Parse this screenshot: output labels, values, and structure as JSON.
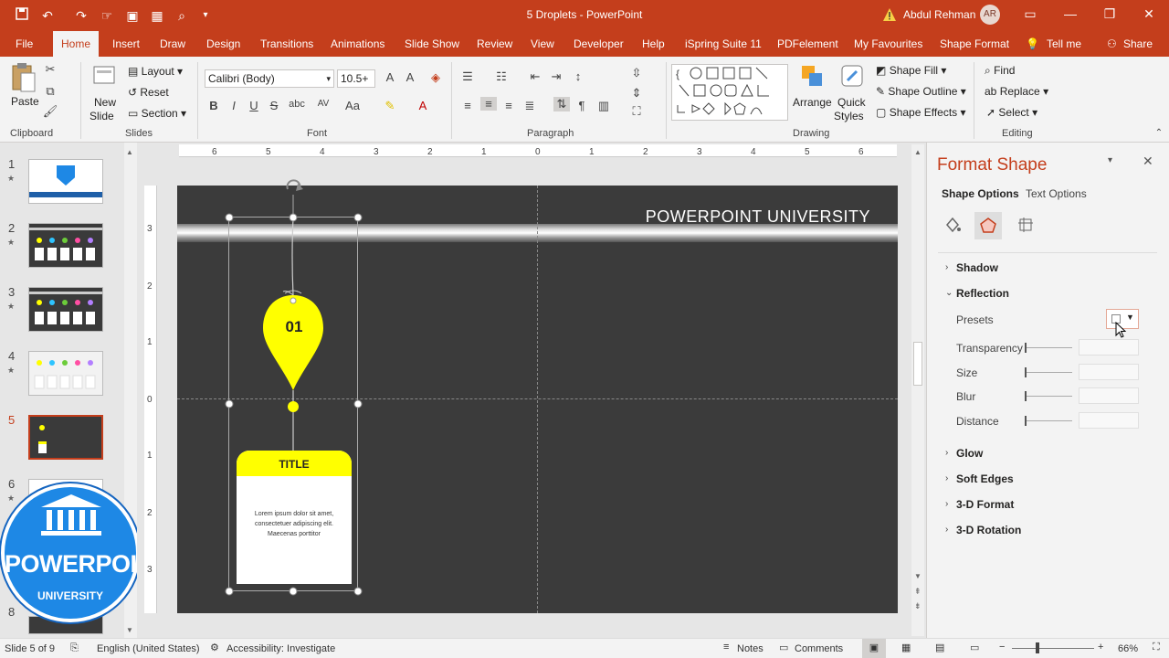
{
  "titlebar": {
    "doc_title": "5 Droplets  -  PowerPoint",
    "user_name": "Abdul Rehman",
    "avatar_initials": "AR"
  },
  "tabs": [
    "File",
    "Home",
    "Insert",
    "Draw",
    "Design",
    "Transitions",
    "Animations",
    "Slide Show",
    "Review",
    "View",
    "Developer",
    "Help",
    "iSpring Suite 11",
    "PDFelement",
    "My Favourites",
    "Shape Format",
    "Tell me",
    "Share"
  ],
  "ribbon": {
    "clipboard": {
      "paste": "Paste",
      "label": "Clipboard"
    },
    "slides": {
      "new_slide_1": "New",
      "new_slide_2": "Slide",
      "layout": "Layout",
      "reset": "Reset",
      "section": "Section",
      "label": "Slides"
    },
    "font": {
      "font_name": "Calibri (Body)",
      "font_size": "10.5+",
      "label": "Font"
    },
    "paragraph": {
      "label": "Paragraph"
    },
    "drawing": {
      "arrange": "Arrange",
      "quick_1": "Quick",
      "quick_2": "Styles",
      "fill": "Shape Fill",
      "outline": "Shape Outline",
      "effects": "Shape Effects",
      "label": "Drawing"
    },
    "editing": {
      "find": "Find",
      "replace": "Replace",
      "select": "Select",
      "label": "Editing"
    }
  },
  "thumbnails": [
    "1",
    "2",
    "3",
    "4",
    "5",
    "6",
    "8"
  ],
  "slide": {
    "title": "POWERPOINT UNIVERSITY",
    "droplet_number": "01",
    "card_title": "TITLE",
    "card_body": [
      "Lorem ipsum dolor sit amet,",
      "consectetuer adipiscing elit.",
      "Maecenas porttitor"
    ]
  },
  "logo": {
    "line1": "POWERPOINT",
    "line2": "UNIVERSITY"
  },
  "format_pane": {
    "title": "Format Shape",
    "tab_shape": "Shape Options",
    "tab_text": "Text Options",
    "shadow": "Shadow",
    "reflection": "Reflection",
    "presets": "Presets",
    "transparency": "Transparency",
    "size": "Size",
    "blur": "Blur",
    "distance": "Distance",
    "glow": "Glow",
    "soft_edges": "Soft Edges",
    "format_3d": "3-D Format",
    "rotation_3d": "3-D Rotation"
  },
  "statusbar": {
    "slide_info": "Slide 5 of 9",
    "language": "English (United States)",
    "accessibility": "Accessibility: Investigate",
    "notes": "Notes",
    "comments": "Comments",
    "zoom": "66%"
  },
  "colors": {
    "accent": "#c43e1c",
    "droplet": "#ffff00",
    "slide_bg": "#3b3b3b"
  }
}
